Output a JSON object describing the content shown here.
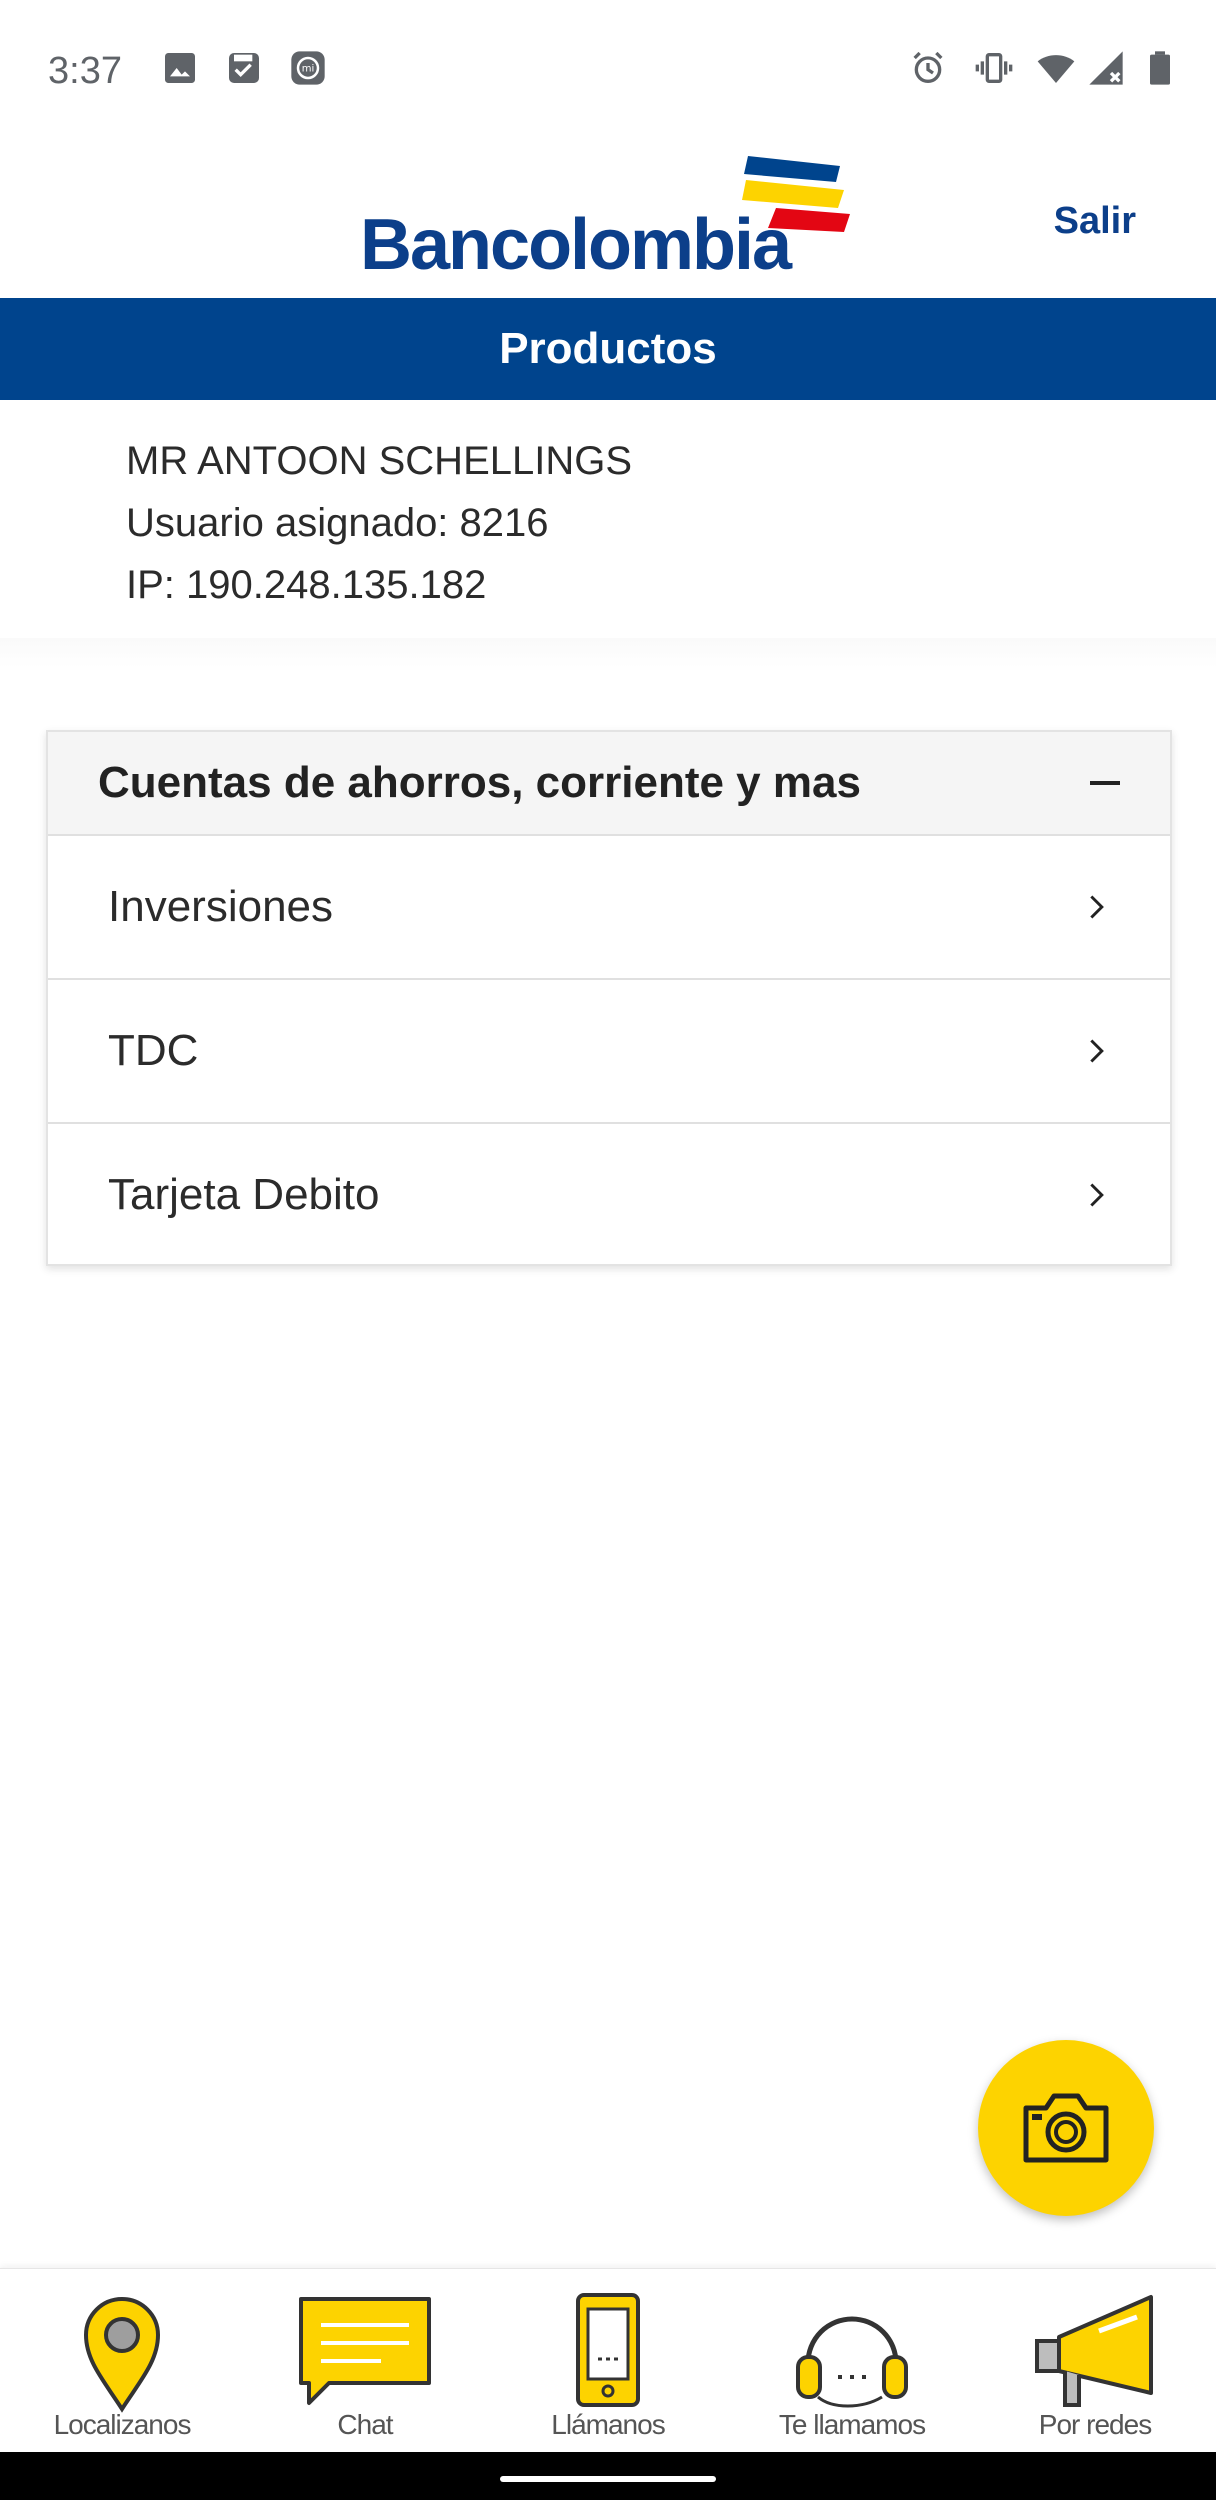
{
  "status_bar": {
    "time": "3:37",
    "icons": [
      "image-icon",
      "save-check-icon",
      "mi-icon",
      "alarm-icon",
      "vibrate-icon",
      "wifi-icon",
      "signal-icon",
      "battery-icon"
    ]
  },
  "header": {
    "logo_text": "Bancolombia",
    "logout_label": "Salir"
  },
  "title_bar": {
    "title": "Productos"
  },
  "user_info": {
    "name": "MR ANTOON SCHELLINGS",
    "user_line": "Usuario asignado: 8216",
    "ip_line": "IP: 190.248.135.182"
  },
  "accounts_card": {
    "title": "Cuentas de ahorros, corriente y mas",
    "items": [
      {
        "label": "Inversiones"
      },
      {
        "label": "TDC"
      },
      {
        "label": "Tarjeta Debito"
      }
    ]
  },
  "bottom_nav": {
    "items": [
      {
        "label": "Localizanos",
        "icon": "location-pin-icon"
      },
      {
        "label": "Chat",
        "icon": "chat-bubble-icon"
      },
      {
        "label": "Llámanos",
        "icon": "phone-icon"
      },
      {
        "label": "Te llamamos",
        "icon": "headset-icon"
      },
      {
        "label": "Por redes",
        "icon": "megaphone-icon"
      }
    ]
  },
  "colors": {
    "brand_blue": "#00448d",
    "brand_yellow": "#fdd300",
    "brand_red": "#e30613"
  }
}
